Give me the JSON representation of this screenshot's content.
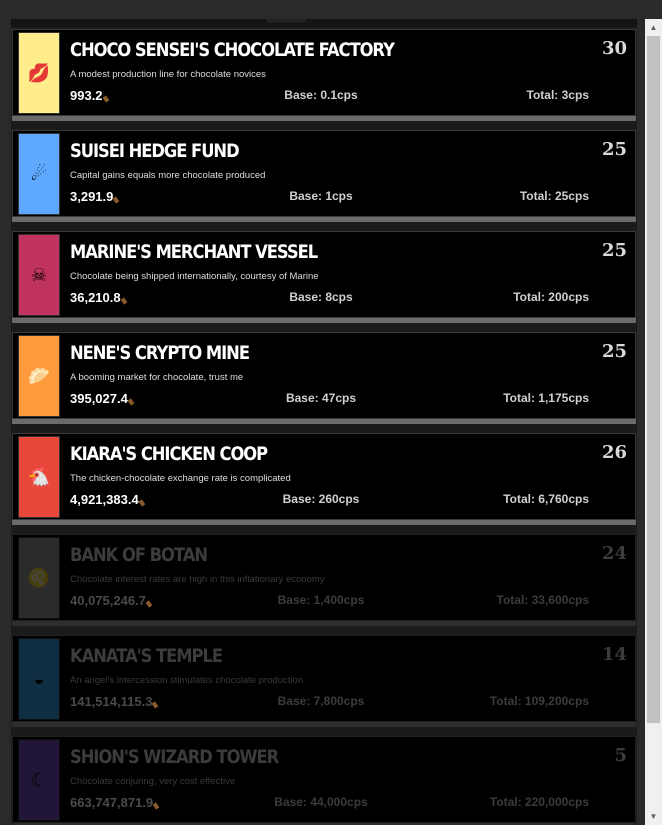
{
  "buildings": [
    {
      "name": "CHOCO SENSEI'S CHOCOLATE FACTORY",
      "description": "A modest production line for chocolate novices",
      "cost": "993.2",
      "base": "Base: 0.1cps",
      "total": "Total: 3cps",
      "count": "30",
      "icon": "lips-icon",
      "icon_glyph": "💋",
      "color": "#ffec8a",
      "locked": false
    },
    {
      "name": "SUISEI HEDGE FUND",
      "description": "Capital gains equals more chocolate produced",
      "cost": "3,291.9",
      "base": "Base: 1cps",
      "total": "Total: 25cps",
      "count": "25",
      "icon": "comet-icon",
      "icon_glyph": "☄",
      "color": "#5ea8ff",
      "locked": false
    },
    {
      "name": "MARINE'S MERCHANT VESSEL",
      "description": "Chocolate being shipped internationally, courtesy of Marine",
      "cost": "36,210.8",
      "base": "Base: 8cps",
      "total": "Total: 200cps",
      "count": "25",
      "icon": "jolly-roger-icon",
      "icon_glyph": "☠",
      "color": "#c0335f",
      "locked": false
    },
    {
      "name": "NENE'S CRYPTO MINE",
      "description": "A booming market for chocolate, trust me",
      "cost": "395,027.4",
      "base": "Base: 47cps",
      "total": "Total: 1,175cps",
      "count": "25",
      "icon": "bread-icon",
      "icon_glyph": "🥟",
      "color": "#ff9a3d",
      "locked": false
    },
    {
      "name": "KIARA'S CHICKEN COOP",
      "description": "The chicken-chocolate exchange rate is complicated",
      "cost": "4,921,383.4",
      "base": "Base: 260cps",
      "total": "Total: 6,760cps",
      "count": "26",
      "icon": "chicken-icon",
      "icon_glyph": "🐔",
      "color": "#e8473c",
      "locked": false
    },
    {
      "name": "BANK OF BOTAN",
      "description": "Chocolate interest rates are high in this inflationary economy",
      "cost": "40,075,246.7",
      "base": "Base: 1,400cps",
      "total": "Total: 33,600cps",
      "count": "24",
      "icon": "lion-icon",
      "icon_glyph": "♌",
      "color": "#9a9a9a",
      "locked": true
    },
    {
      "name": "KANATA'S TEMPLE",
      "description": "An angel's intercession stimulates chocolate production",
      "cost": "141,514,115.3",
      "base": "Base: 7,800cps",
      "total": "Total: 109,200cps",
      "count": "14",
      "icon": "halo-icon",
      "icon_glyph": "◒",
      "color": "#3aa7e8",
      "locked": true
    },
    {
      "name": "SHION'S WIZARD TOWER",
      "description": "Chocolate conjuring, very cost effective",
      "cost": "663,747,871.9",
      "base": "Base: 44,000cps",
      "total": "Total: 220,000cps",
      "count": "5",
      "icon": "crescent-moon-icon",
      "icon_glyph": "☾",
      "color": "#7a4fc8",
      "locked": true
    }
  ]
}
